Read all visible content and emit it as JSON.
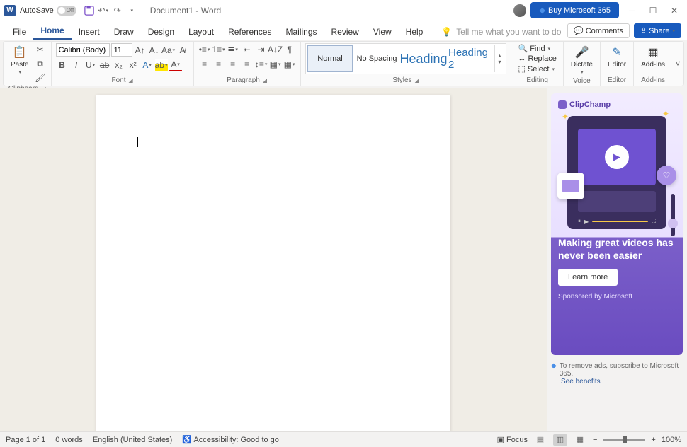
{
  "titlebar": {
    "autosave_label": "AutoSave",
    "autosave_state": "Off",
    "doc_title": "Document1  -  Word",
    "buy_label": "Buy Microsoft 365"
  },
  "tabs": {
    "file": "File",
    "home": "Home",
    "insert": "Insert",
    "draw": "Draw",
    "design": "Design",
    "layout": "Layout",
    "references": "References",
    "mailings": "Mailings",
    "review": "Review",
    "view": "View",
    "help": "Help",
    "tellme_placeholder": "Tell me what you want to do",
    "comments": "Comments",
    "share": "Share"
  },
  "ribbon": {
    "clipboard": {
      "paste": "Paste",
      "label": "Clipboard"
    },
    "font": {
      "name": "Calibri (Body)",
      "size": "11",
      "label": "Font"
    },
    "paragraph": {
      "label": "Paragraph"
    },
    "styles": {
      "normal": "Normal",
      "nospacing": "No Spacing",
      "heading1": "Heading",
      "heading2": "Heading 2",
      "label": "Styles"
    },
    "editing": {
      "find": "Find",
      "replace": "Replace",
      "select": "Select",
      "label": "Editing"
    },
    "voice": {
      "dictate": "Dictate",
      "label": "Voice"
    },
    "editor": {
      "editor": "Editor",
      "label": "Editor"
    },
    "addins": {
      "addins": "Add-ins",
      "label": "Add-ins"
    }
  },
  "ad": {
    "brand": "ClipChamp",
    "headline": "Making great videos has never been easier",
    "learn": "Learn more",
    "sponsor": "Sponsored by Microsoft",
    "remove": "To remove ads, subscribe to Microsoft 365.",
    "benefits": "See benefits"
  },
  "status": {
    "page": "Page 1 of 1",
    "words": "0 words",
    "lang": "English (United States)",
    "accessibility": "Accessibility: Good to go",
    "focus": "Focus",
    "zoom": "100%"
  }
}
